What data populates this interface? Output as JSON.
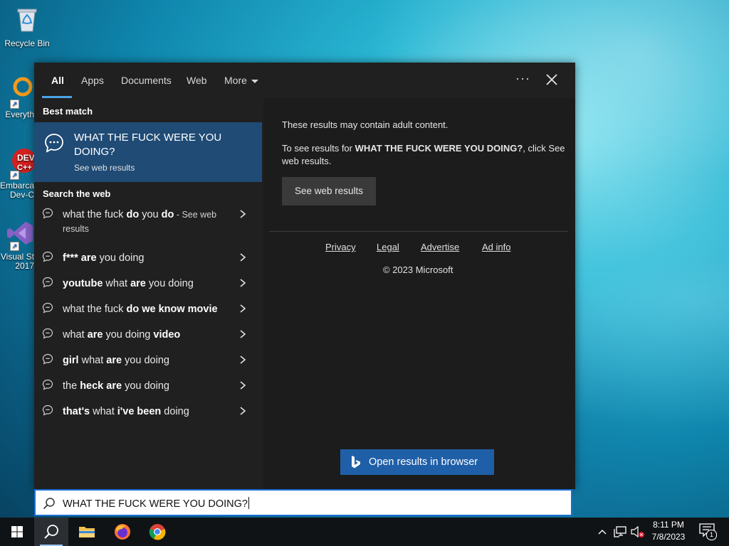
{
  "desktop": {
    "icons": [
      {
        "label": "Recycle Bin"
      },
      {
        "label": "Everyth"
      },
      {
        "label": "Embarca Dev-C"
      },
      {
        "label": "Visual St 2017"
      }
    ]
  },
  "search_panel": {
    "tabs": [
      {
        "label": "All"
      },
      {
        "label": "Apps"
      },
      {
        "label": "Documents"
      },
      {
        "label": "Web"
      },
      {
        "label": "More"
      }
    ],
    "best_match_heading": "Best match",
    "best_match": {
      "title": "WHAT THE FUCK WERE YOU DOING?",
      "subtitle": "See web results"
    },
    "search_web_heading": "Search the web",
    "suggestions": [
      {
        "parts": [
          {
            "t": "what the fuck ",
            "b": false
          },
          {
            "t": "do",
            "b": true
          },
          {
            "t": " you ",
            "b": false
          },
          {
            "t": "do",
            "b": true
          }
        ],
        "see": " - See web results"
      },
      {
        "parts": [
          {
            "t": "f***",
            "b": true
          },
          {
            "t": " ",
            "b": false
          },
          {
            "t": "are",
            "b": true
          },
          {
            "t": " you doing",
            "b": false
          }
        ]
      },
      {
        "parts": [
          {
            "t": "youtube",
            "b": true
          },
          {
            "t": " what ",
            "b": false
          },
          {
            "t": "are",
            "b": true
          },
          {
            "t": " you doing",
            "b": false
          }
        ]
      },
      {
        "parts": [
          {
            "t": "what the fuck ",
            "b": false
          },
          {
            "t": "do we know movie",
            "b": true
          }
        ]
      },
      {
        "parts": [
          {
            "t": "what ",
            "b": false
          },
          {
            "t": "are",
            "b": true
          },
          {
            "t": " you doing ",
            "b": false
          },
          {
            "t": "video",
            "b": true
          }
        ]
      },
      {
        "parts": [
          {
            "t": "girl",
            "b": true
          },
          {
            "t": " what ",
            "b": false
          },
          {
            "t": "are",
            "b": true
          },
          {
            "t": " you doing",
            "b": false
          }
        ]
      },
      {
        "parts": [
          {
            "t": "the ",
            "b": false
          },
          {
            "t": "heck are",
            "b": true
          },
          {
            "t": " you doing",
            "b": false
          }
        ]
      },
      {
        "parts": [
          {
            "t": "that's",
            "b": true
          },
          {
            "t": " what ",
            "b": false
          },
          {
            "t": "i've been",
            "b": true
          },
          {
            "t": " doing",
            "b": false
          }
        ]
      }
    ],
    "preview": {
      "adult_notice": "These results may contain adult content.",
      "see_results_prefix": "To see results for ",
      "see_results_query": "WHAT THE FUCK WERE YOU DOING?",
      "see_results_suffix": ", click See web results.",
      "see_web_button": "See web results",
      "footer_links": [
        "Privacy",
        "Legal",
        "Advertise",
        "Ad info"
      ],
      "copyright": "© 2023 Microsoft",
      "open_browser_button": "Open results in browser"
    }
  },
  "search_box": {
    "query": "WHAT THE FUCK WERE YOU DOING?"
  },
  "taskbar": {
    "time": "8:11 PM",
    "date": "7/8/2023",
    "notification_count": "1"
  },
  "colors": {
    "panel_bg": "#202020",
    "best_match_bg": "#1f4b75",
    "accent": "#4aa3e8",
    "open_browser_bg": "#1f5fa8",
    "taskbar_bg": "#101316"
  }
}
